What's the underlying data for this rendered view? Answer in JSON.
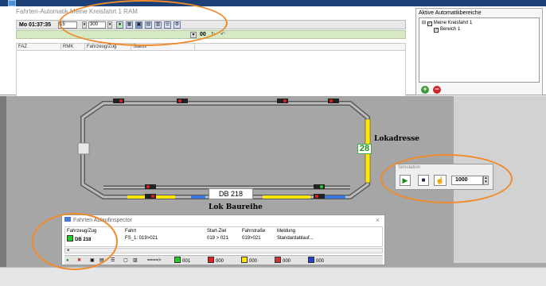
{
  "main_window": {
    "title": "Fahrten-Automatik Meine Kreisfahrt 1 RAM",
    "close": "×"
  },
  "toolbar": {
    "time": "Mo 01:37:35",
    "value1": "15",
    "value2": "300"
  },
  "toolbar2": {
    "value": "00"
  },
  "table": {
    "columns": [
      "FAZ",
      "RMK",
      "Fahrzeug/Zug",
      "Status"
    ]
  },
  "right_panel": {
    "title": "Aktive Automatikbereiche",
    "tree": [
      "Meine Kreisfahrt 1",
      "Bereich 1"
    ]
  },
  "layout_labels": {
    "lokadresse": "Lokadresse",
    "lok_baureihe": "Lok Baureihe",
    "loc_number": "28",
    "train_name": "DB 218"
  },
  "simulation": {
    "title": "Simulation",
    "speed": "1000"
  },
  "inspector": {
    "title": "Fahrten Ablaufinspector",
    "close": "×",
    "columns": [
      "Fahrzeug/Zug",
      "Fahrt",
      "Start-Ziel",
      "Fahrstraße",
      "Meldung"
    ],
    "row": [
      "DB 218",
      "FS_1: 019>021",
      "019 > 021",
      "019>021",
      "Standardablauf..."
    ],
    "toolbar": {
      "arrow": "====>",
      "v1": "001",
      "v2": "000",
      "v3": "000",
      "v4": "000",
      "v5": "000"
    }
  },
  "colors": {
    "highlight": "#f08a2a",
    "track_block": "#ffe800",
    "status_green": "#22cc22"
  }
}
